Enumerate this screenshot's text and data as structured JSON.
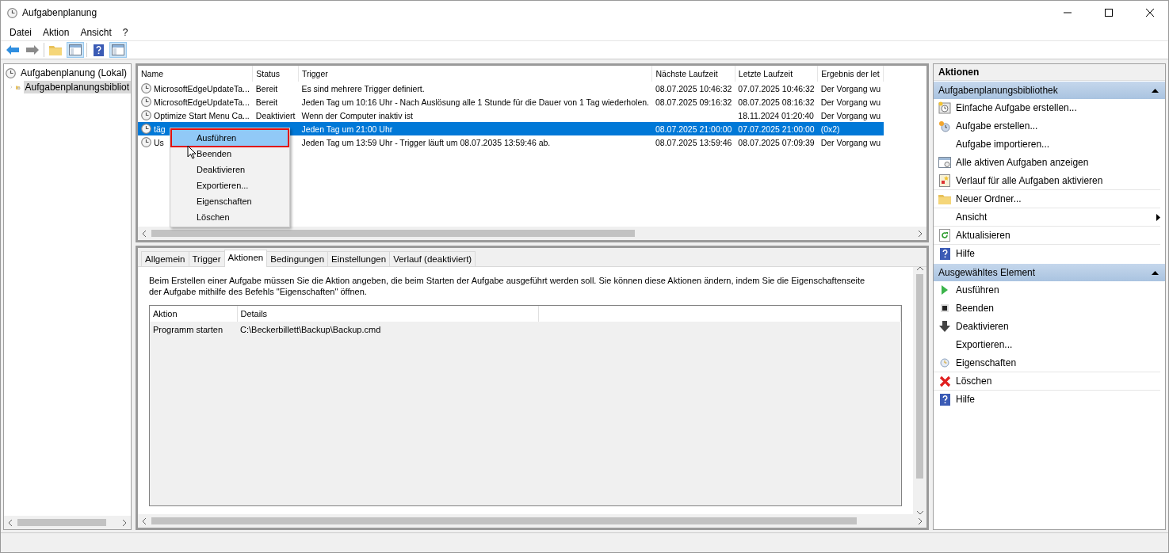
{
  "window": {
    "title": "Aufgabenplanung"
  },
  "menu": [
    "Datei",
    "Aktion",
    "Ansicht",
    "?"
  ],
  "tree": [
    {
      "label": "Aufgabenplanung (Lokal)",
      "selected": false,
      "children": [
        {
          "label": "Aufgabenplanungsbibliot",
          "expanded": false,
          "selected": true
        }
      ]
    }
  ],
  "tasks": {
    "columns": [
      "Name",
      "Status",
      "Trigger",
      "Nächste Laufzeit",
      "Letzte Laufzeit",
      "Ergebnis der let"
    ],
    "rows": [
      {
        "name": "MicrosoftEdgeUpdateTa...",
        "status": "Bereit",
        "trigger": "Es sind mehrere Trigger definiert.",
        "next_run": "08.07.2025 10:46:32",
        "last_run": "07.07.2025 10:46:32",
        "result": "Der Vorgang wu",
        "selected": false
      },
      {
        "name": "MicrosoftEdgeUpdateTa...",
        "status": "Bereit",
        "trigger": "Jeden Tag um 10:16 Uhr - Nach Auslösung alle 1 Stunde für die Dauer von 1 Tag wiederholen.",
        "next_run": "08.07.2025 09:16:32",
        "last_run": "08.07.2025 08:16:32",
        "result": "Der Vorgang wu",
        "selected": false
      },
      {
        "name": "Optimize Start Menu Ca...",
        "status": "Deaktiviert",
        "trigger": "Wenn der Computer inaktiv ist",
        "last_run": "18.11.2024 01:20:40",
        "result": "Der Vorgang wu",
        "selected": false
      },
      {
        "name": "täg",
        "trigger": "Jeden Tag um 21:00 Uhr",
        "next_run": "08.07.2025 21:00:00",
        "last_run": "07.07.2025 21:00:00",
        "result": "(0x2)",
        "selected": true
      },
      {
        "name": "Us",
        "trigger": "Jeden Tag um 13:59 Uhr - Trigger läuft um 08.07.2035 13:59:46 ab.",
        "next_run": "08.07.2025 13:59:46",
        "last_run": "08.07.2025 07:09:39",
        "result": "Der Vorgang wu",
        "selected": false
      }
    ]
  },
  "context_menu": {
    "items": [
      {
        "label": "Ausführen",
        "highlighted": true
      },
      {
        "label": "Beenden",
        "highlighted": false
      },
      {
        "label": "Deaktivieren",
        "highlighted": false
      },
      {
        "label": "Exportieren...",
        "highlighted": false
      },
      {
        "label": "Eigenschaften",
        "highlighted": false
      },
      {
        "label": "Löschen",
        "highlighted": false
      }
    ]
  },
  "details": {
    "tabs": [
      {
        "label": "Allgemein",
        "selected": false
      },
      {
        "label": "Trigger",
        "selected": false
      },
      {
        "label": "Aktionen",
        "selected": true
      },
      {
        "label": "Bedingungen",
        "selected": false
      },
      {
        "label": "Einstellungen",
        "selected": false
      },
      {
        "label": "Verlauf (deaktiviert)",
        "selected": false
      }
    ],
    "description": "Beim Erstellen einer Aufgabe müssen Sie die Aktion angeben, die beim Starten der Aufgabe ausgeführt werden soll. Sie können diese Aktionen ändern, indem Sie die Eigenschaftenseite der Aufgabe mithilfe des Befehls \"Eigenschaften\" öffnen.",
    "actions_table": {
      "columns": [
        "Aktion",
        "Details"
      ],
      "rows": [
        [
          "Programm starten",
          "C:\\Beckerbillett\\Backup\\Backup.cmd"
        ]
      ]
    }
  },
  "actions_panel": {
    "title": "Aktionen",
    "sections": [
      {
        "title": "Aufgabenplanungsbibliothek",
        "expanded": true,
        "items": [
          {
            "label": "Einfache Aufgabe erstellen...",
            "submenu": false,
            "divider_after": false
          },
          {
            "label": "Aufgabe erstellen...",
            "submenu": false,
            "divider_after": false
          },
          {
            "label": "Aufgabe importieren...",
            "submenu": false,
            "divider_after": false
          },
          {
            "label": "Alle aktiven Aufgaben anzeigen",
            "submenu": false,
            "divider_after": false
          },
          {
            "label": "Verlauf für alle Aufgaben aktivieren",
            "submenu": false,
            "divider_after": true
          },
          {
            "label": "Neuer Ordner...",
            "submenu": false,
            "divider_after": true
          },
          {
            "label": "Ansicht",
            "submenu": true,
            "divider_after": true
          },
          {
            "label": "Aktualisieren",
            "submenu": false,
            "divider_after": true
          },
          {
            "label": "Hilfe",
            "submenu": false,
            "divider_after": false
          }
        ]
      },
      {
        "title": "Ausgewähltes Element",
        "expanded": true,
        "items": [
          {
            "label": "Ausführen",
            "submenu": false,
            "divider_after": false
          },
          {
            "label": "Beenden",
            "submenu": false,
            "divider_after": false
          },
          {
            "label": "Deaktivieren",
            "submenu": false,
            "divider_after": false
          },
          {
            "label": "Exportieren...",
            "submenu": false,
            "divider_after": false
          },
          {
            "label": "Eigenschaften",
            "submenu": false,
            "divider_after": true
          },
          {
            "label": "Löschen",
            "submenu": false,
            "divider_after": true
          },
          {
            "label": "Hilfe",
            "submenu": false,
            "divider_after": false
          }
        ]
      }
    ]
  }
}
